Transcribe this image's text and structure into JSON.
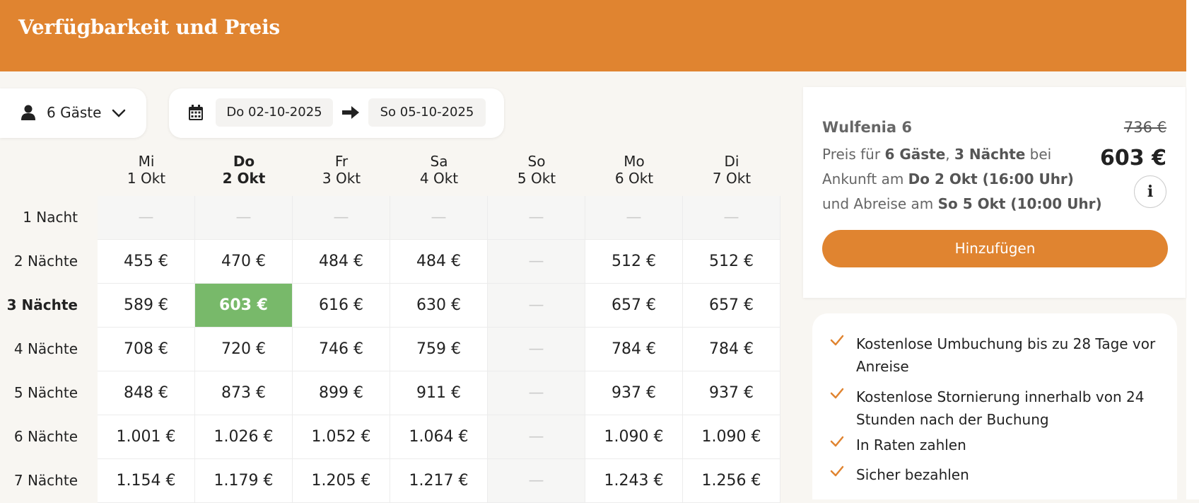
{
  "header": {
    "title": "Verfügbarkeit und Preis"
  },
  "guests": {
    "label": "6 Gäste"
  },
  "dates": {
    "arrival": "Do 02-10-2025",
    "departure": "So 05-10-2025"
  },
  "calendar": {
    "columns": [
      {
        "day": "Mi",
        "date": "1 Okt"
      },
      {
        "day": "Do",
        "date": "2 Okt"
      },
      {
        "day": "Fr",
        "date": "3 Okt"
      },
      {
        "day": "Sa",
        "date": "4 Okt"
      },
      {
        "day": "So",
        "date": "5 Okt"
      },
      {
        "day": "Mo",
        "date": "6 Okt"
      },
      {
        "day": "Di",
        "date": "7 Okt"
      }
    ],
    "rows": [
      {
        "label": "1 Nacht",
        "prices": [
          "—",
          "—",
          "—",
          "—",
          "—",
          "—",
          "—"
        ]
      },
      {
        "label": "2 Nächte",
        "prices": [
          "455 €",
          "470 €",
          "484 €",
          "484 €",
          "—",
          "512 €",
          "512 €"
        ]
      },
      {
        "label": "3 Nächte",
        "prices": [
          "589 €",
          "603 €",
          "616 €",
          "630 €",
          "—",
          "657 €",
          "657 €"
        ]
      },
      {
        "label": "4 Nächte",
        "prices": [
          "708 €",
          "720 €",
          "746 €",
          "759 €",
          "—",
          "784 €",
          "784 €"
        ]
      },
      {
        "label": "5 Nächte",
        "prices": [
          "848 €",
          "873 €",
          "899 €",
          "911 €",
          "—",
          "937 €",
          "937 €"
        ]
      },
      {
        "label": "6 Nächte",
        "prices": [
          "1.001 €",
          "1.026 €",
          "1.052 €",
          "1.064 €",
          "—",
          "1.090 €",
          "1.090 €"
        ]
      },
      {
        "label": "7 Nächte",
        "prices": [
          "1.154 €",
          "1.179 €",
          "1.205 €",
          "1.217 €",
          "—",
          "1.243 €",
          "1.256 €"
        ]
      }
    ],
    "selected": {
      "row": 2,
      "col": 1
    }
  },
  "summary": {
    "name": "Wulfenia 6",
    "old_price": "736 €",
    "price": "603 €",
    "desc_1": "Preis für ",
    "desc_guests": "6 Gäste",
    "desc_2": ", ",
    "desc_nights": "3 Nächte",
    "desc_3": " bei Ankunft am ",
    "desc_arrival": "Do 2 Okt (16:00 Uhr)",
    "desc_4": " und Abreise am ",
    "desc_departure": "So 5 Okt (10:00 Uhr)",
    "info_label": "i",
    "add_label": "Hinzufügen"
  },
  "features": [
    "Kostenlose Umbuchung bis zu 28 Tage vor Anreise",
    "Kostenlose Stornierung innerhalb von 24 Stunden nach der Buchung",
    "In Raten zahlen",
    "Sicher bezahlen"
  ],
  "colors": {
    "accent": "#e08430",
    "selected": "#78b96a",
    "background": "#f8f6f2"
  }
}
